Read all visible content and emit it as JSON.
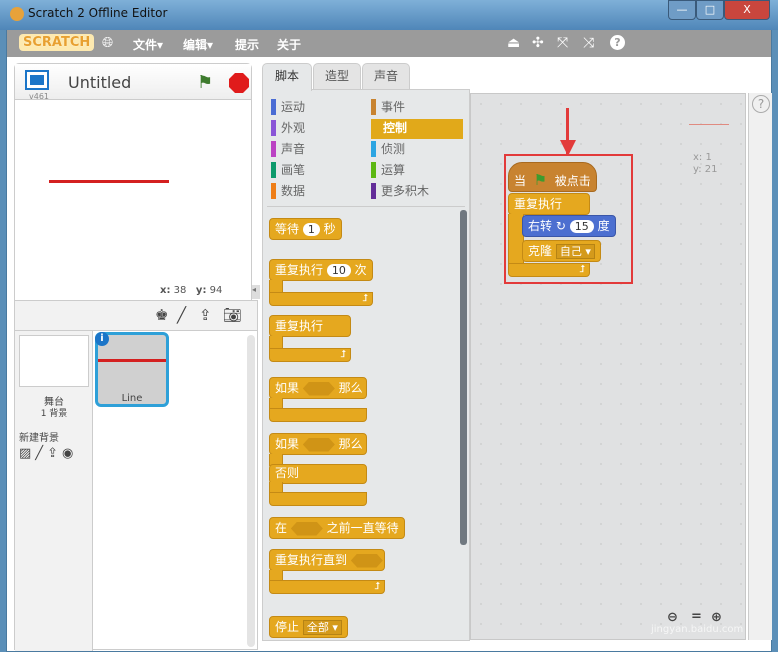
{
  "window": {
    "title": "Scratch 2 Offline Editor",
    "minimize": "—",
    "maximize": "□",
    "close": "X"
  },
  "menubar": {
    "logo": "SCRATCH",
    "items": [
      "文件▾",
      "编辑▾",
      "提示",
      "关于"
    ],
    "tools": [
      "stamp-icon",
      "cut-icon",
      "grow-icon",
      "shrink-icon",
      "help-icon"
    ]
  },
  "stage": {
    "project_title": "Untitled",
    "version": "v461",
    "x_label": "x:",
    "x": "38",
    "y_label": "y:",
    "y": "94",
    "line_color": "#d42020"
  },
  "sprites": {
    "stage_label": "舞台",
    "backdrop_count": "1 背景",
    "new_backdrop": "新建背景",
    "sprite_name": "Line"
  },
  "tabs": [
    "脚本",
    "造型",
    "声音"
  ],
  "categories": {
    "left": [
      {
        "label": "运动",
        "color": "#4a6cd4"
      },
      {
        "label": "外观",
        "color": "#8a55d7"
      },
      {
        "label": "声音",
        "color": "#bb42c3"
      },
      {
        "label": "画笔",
        "color": "#0e9a6c"
      },
      {
        "label": "数据",
        "color": "#ee7d16"
      }
    ],
    "right": [
      {
        "label": "事件",
        "color": "#c88330"
      },
      {
        "label": "控制",
        "color": "#e1a91a"
      },
      {
        "label": "侦测",
        "color": "#2ca5e2"
      },
      {
        "label": "运算",
        "color": "#5cb712"
      },
      {
        "label": "更多积木",
        "color": "#632d99"
      }
    ]
  },
  "palette": {
    "wait": "等待",
    "wait_val": "1",
    "wait_unit": "秒",
    "repeat": "重复执行",
    "repeat_val": "10",
    "repeat_unit": "次",
    "forever": "重复执行",
    "if": "如果",
    "then": "那么",
    "if2": "如果",
    "then2": "那么",
    "else": "否则",
    "wait_until_a": "在",
    "wait_until_b": "之前一直等待",
    "repeat_until": "重复执行直到",
    "stop": "停止",
    "stop_val": "全部"
  },
  "script": {
    "hat_a": "当",
    "hat_b": "被点击",
    "forever": "重复执行",
    "turn": "右转",
    "turn_val": "15",
    "turn_unit": "度",
    "clone": "克隆",
    "clone_val": "自己",
    "sprite_x": "x: 1",
    "sprite_y": "y: 21"
  },
  "zoom": {
    "out": "zoom-out-icon",
    "reset": "=",
    "in": "zoom-in-icon"
  },
  "watermark": "jingyan.baidu.com"
}
